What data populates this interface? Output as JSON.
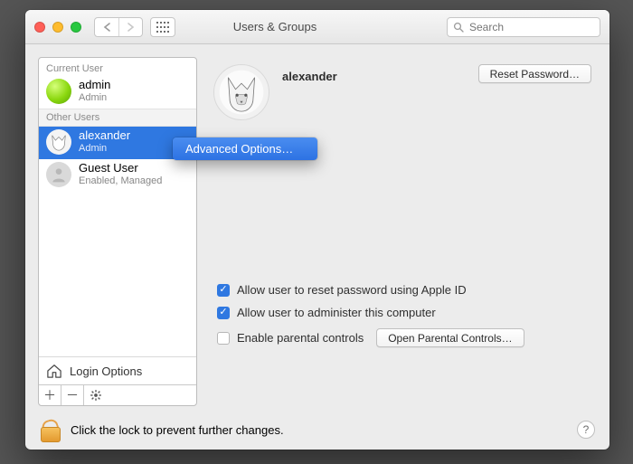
{
  "window": {
    "title": "Users & Groups"
  },
  "search": {
    "placeholder": "Search"
  },
  "sidebar": {
    "current_label": "Current User",
    "other_label": "Other Users",
    "current": {
      "name": "admin",
      "role": "Admin"
    },
    "others": [
      {
        "name": "alexander",
        "role": "Admin"
      },
      {
        "name": "Guest User",
        "role": "Enabled, Managed"
      }
    ],
    "login_options": "Login Options"
  },
  "context_menu": {
    "item": "Advanced Options…"
  },
  "detail": {
    "name": "alexander",
    "reset_password": "Reset Password…",
    "opt_reset_apple": "Allow user to reset password using Apple ID",
    "opt_admin": "Allow user to administer this computer",
    "opt_parental": "Enable parental controls",
    "open_parental": "Open Parental Controls…"
  },
  "footer": {
    "lock_text": "Click the lock to prevent further changes."
  }
}
